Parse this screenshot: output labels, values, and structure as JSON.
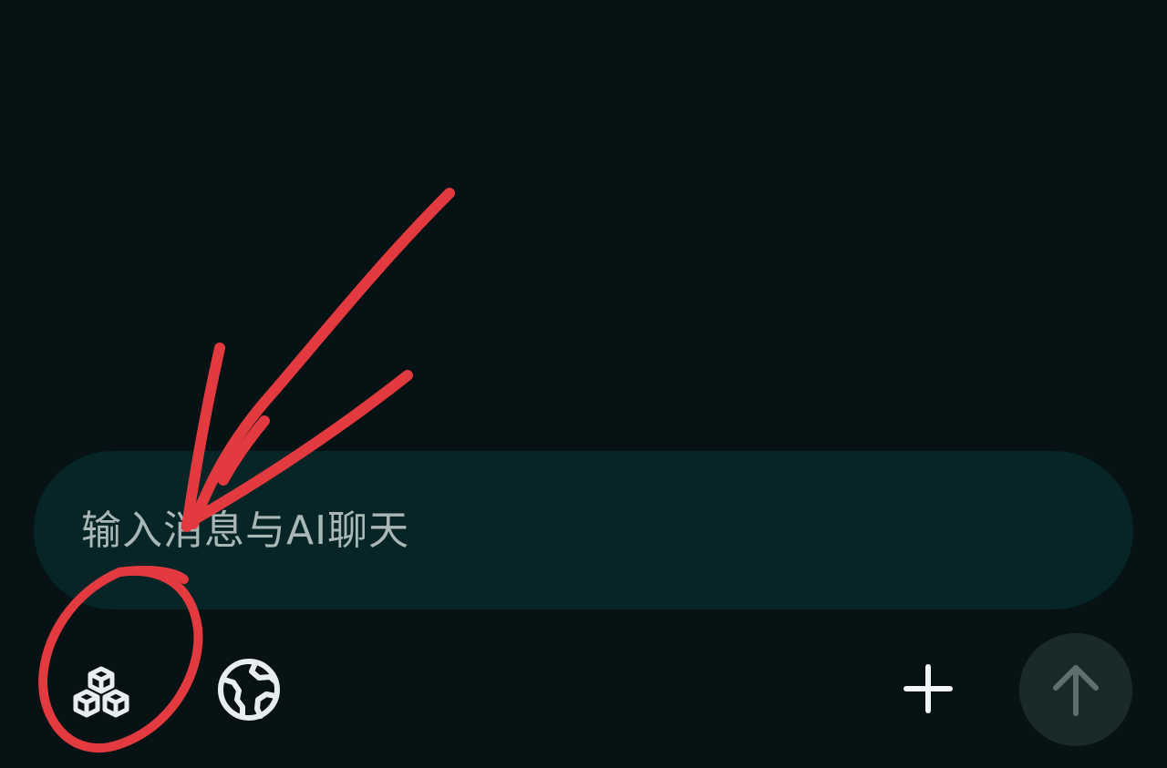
{
  "composer": {
    "placeholder": "输入消息与AI聊天"
  },
  "toolbar": {
    "tools_icon": "cubes-icon",
    "web_icon": "globe-icon",
    "add_icon": "plus-icon",
    "send_icon": "arrow-up-icon"
  },
  "colors": {
    "background": "#071214",
    "input_background": "#072526",
    "placeholder_text": "#a9b7b6",
    "icon": "#e6efee",
    "send_button": "#1a2a2b",
    "send_icon": "#5f6e6e",
    "annotation": "#e33a3f"
  }
}
